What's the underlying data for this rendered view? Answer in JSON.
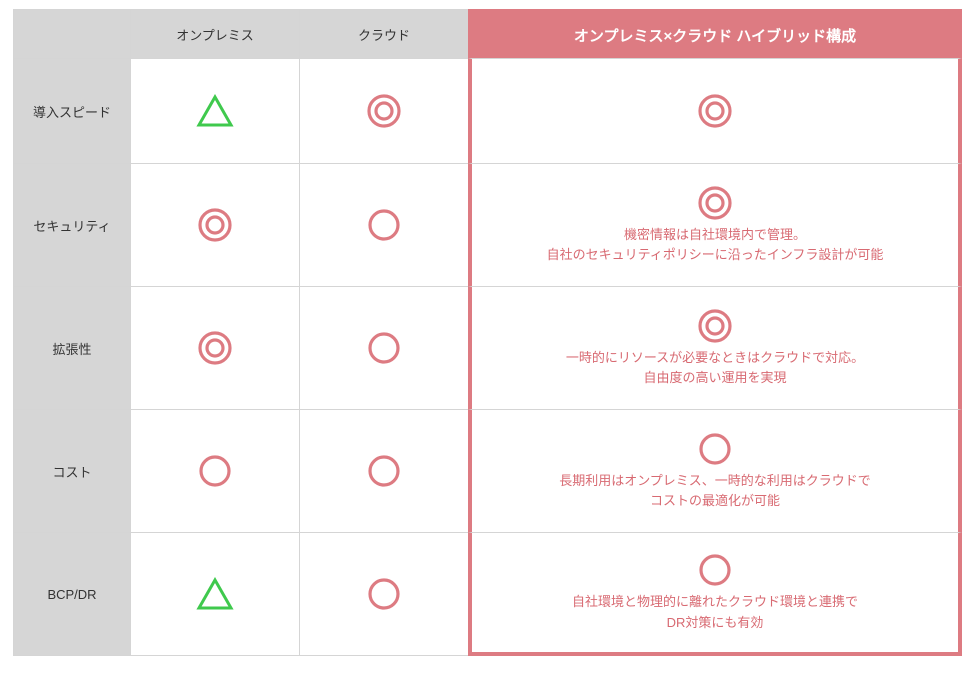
{
  "colors": {
    "accent": "#dd7b82",
    "accent_dark": "#d86a72",
    "green": "#3fc94d",
    "header_bg": "#d6d6d6",
    "border": "#d5d5d5"
  },
  "icons": {
    "double_circle": "◎",
    "circle": "○",
    "triangle": "△"
  },
  "columns": {
    "rowhead": "",
    "onprem": "オンプレミス",
    "cloud": "クラウド",
    "hybrid": "オンプレミス×クラウド ハイブリッド構成"
  },
  "rows": [
    {
      "key": "speed",
      "label": "導入スピード",
      "onprem": {
        "icon": "triangle",
        "color": "green"
      },
      "cloud": {
        "icon": "double_circle",
        "color": "accent"
      },
      "hybrid": {
        "icon": "double_circle",
        "color": "accent",
        "desc": ""
      }
    },
    {
      "key": "security",
      "label": "セキュリティ",
      "onprem": {
        "icon": "double_circle",
        "color": "accent"
      },
      "cloud": {
        "icon": "circle",
        "color": "accent"
      },
      "hybrid": {
        "icon": "double_circle",
        "color": "accent",
        "desc": "機密情報は自社環境内で管理。\n自社のセキュリティポリシーに沿ったインフラ設計が可能"
      }
    },
    {
      "key": "scalability",
      "label": "拡張性",
      "onprem": {
        "icon": "double_circle",
        "color": "accent"
      },
      "cloud": {
        "icon": "circle",
        "color": "accent"
      },
      "hybrid": {
        "icon": "double_circle",
        "color": "accent",
        "desc": "一時的にリソースが必要なときはクラウドで対応。\n自由度の高い運用を実現"
      }
    },
    {
      "key": "cost",
      "label": "コスト",
      "onprem": {
        "icon": "circle",
        "color": "accent"
      },
      "cloud": {
        "icon": "circle",
        "color": "accent"
      },
      "hybrid": {
        "icon": "circle",
        "color": "accent",
        "desc": "長期利用はオンプレミス、一時的な利用はクラウドで\nコストの最適化が可能"
      }
    },
    {
      "key": "bcpdr",
      "label": "BCP/DR",
      "onprem": {
        "icon": "triangle",
        "color": "green"
      },
      "cloud": {
        "icon": "circle",
        "color": "accent"
      },
      "hybrid": {
        "icon": "circle",
        "color": "accent",
        "desc": "自社環境と物理的に離れたクラウド環境と連携で\nDR対策にも有効"
      }
    }
  ]
}
